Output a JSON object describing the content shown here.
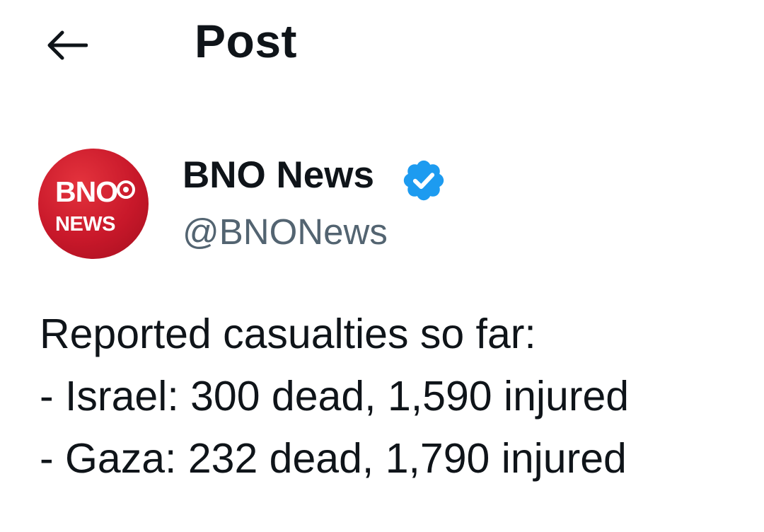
{
  "header": {
    "back_icon": "arrow-left-icon",
    "title": "Post"
  },
  "author": {
    "avatar": {
      "line1": "BNO",
      "line2": "NEWS",
      "background": "#c8182a"
    },
    "display_name": "BNO News",
    "verified_icon": "verified-badge-icon",
    "verified_color": "#1d9bf0",
    "handle": "@BNONews"
  },
  "post": {
    "lines": [
      "Reported casualties so far:",
      "- Israel: 300 dead, 1,590 injured",
      "- Gaza: 232 dead, 1,790 injured"
    ]
  }
}
